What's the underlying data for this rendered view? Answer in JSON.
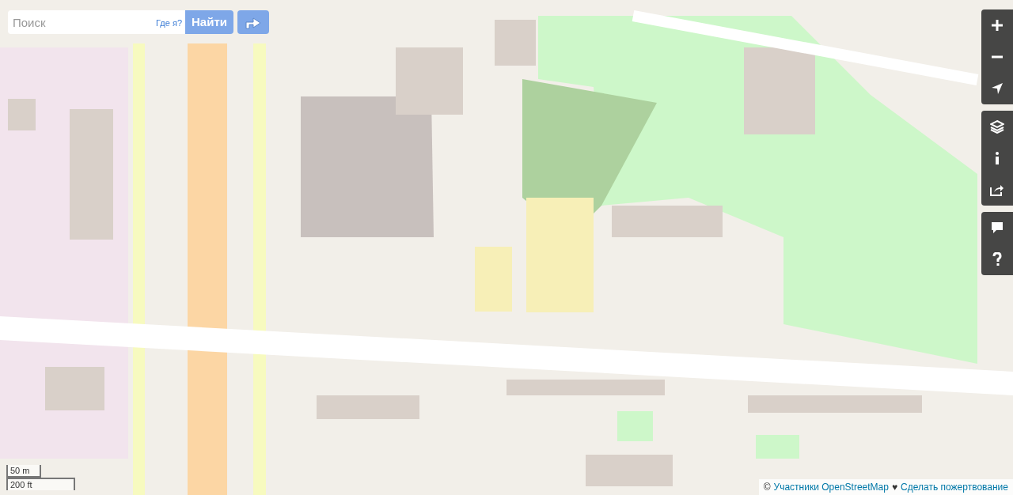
{
  "search": {
    "placeholder": "Поиск",
    "where_am_i": "Где я?",
    "submit": "Найти"
  },
  "scale": {
    "metric": "50 m",
    "imperial": "200 ft"
  },
  "attribution": {
    "copyright": "©",
    "contributors": "Участники OpenStreetMap",
    "heart": "♥",
    "donate": "Сделать пожертвование"
  }
}
